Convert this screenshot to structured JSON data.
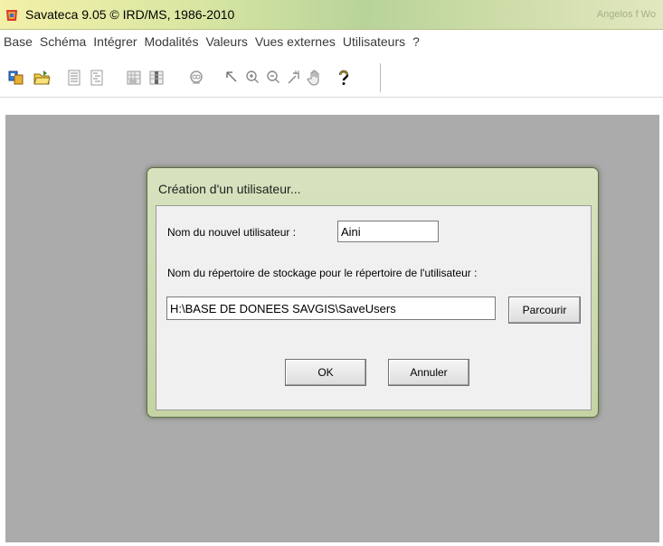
{
  "window": {
    "title": "Savateca 9.05 © IRD/MS, 1986-2010",
    "title_right_blur": "Angelos f  Wo"
  },
  "menu": [
    "Base",
    "Schéma",
    "Intégrer",
    "Modalités",
    "Valeurs",
    "Vues externes",
    "Utilisateurs",
    "?"
  ],
  "toolbar": {
    "icons": [
      "open-base-icon",
      "open-folder-icon",
      "text-align-icon",
      "text-list-icon",
      "grid-icon",
      "grid-select-icon",
      "zoom-glass-icon",
      "arrow-pointer-icon",
      "zoom-in-icon",
      "zoom-out-icon",
      "pan-icon",
      "hand-icon",
      "help-icon"
    ]
  },
  "dialog": {
    "title": "Création d'un utilisateur...",
    "user_label": "Nom du nouvel utilisateur :",
    "user_value": "Aini",
    "dir_label": "Nom du répertoire de stockage pour le répertoire de l'utilisateur :",
    "dir_value": "H:\\BASE DE DONEES SAVGIS\\SaveUsers",
    "browse_label": "Parcourir",
    "ok_label": "OK",
    "cancel_label": "Annuler"
  },
  "colors": {
    "workspace": "#ababab",
    "dialog_frame": "#c8d7aa",
    "dialog_body": "#f0f0f0"
  }
}
